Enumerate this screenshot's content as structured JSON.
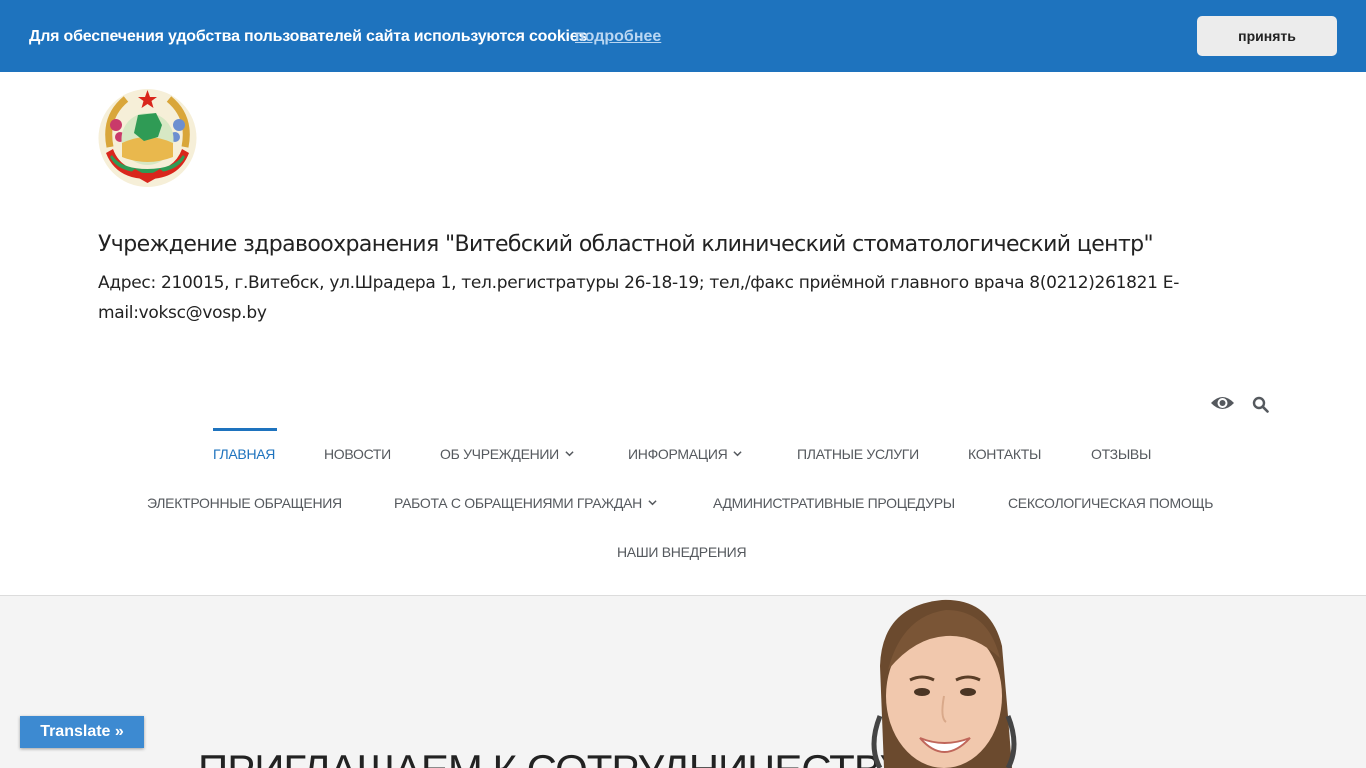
{
  "cookie_bar": {
    "message": "Для обеспечения удобства пользователей сайта используются cookies",
    "more_link": "подробнее",
    "accept_label": "принять",
    "bg_color": "#1e73be"
  },
  "header": {
    "emblem_icon": "belarus-coat-of-arms",
    "title": "Учреждение здравоохранения \"Витебский областной клинический стоматологический центр\"",
    "address": "Адрес: 210015, г.Витебск, ул.Шрадера 1, тел.регистратуры 26-18-19; тел,/факс приёмной главного врача 8(0212)261821 E-mail:voksc@vosp.by"
  },
  "tools": {
    "eye_icon": "eye-icon",
    "search_icon": "search-icon"
  },
  "nav": {
    "accent_color": "#1e73be",
    "row1": [
      {
        "label": "Главная",
        "active": true,
        "dropdown": false
      },
      {
        "label": "Новости",
        "active": false,
        "dropdown": false
      },
      {
        "label": "Об учреждении",
        "active": false,
        "dropdown": true
      },
      {
        "label": "Информация",
        "active": false,
        "dropdown": true
      },
      {
        "label": "Платные услуги",
        "active": false,
        "dropdown": false
      },
      {
        "label": "Контакты",
        "active": false,
        "dropdown": false
      },
      {
        "label": "Отзывы",
        "active": false,
        "dropdown": false
      }
    ],
    "row2": [
      {
        "label": "Электронные обращения",
        "active": false,
        "dropdown": false
      },
      {
        "label": "Работа с обращениями граждан",
        "active": false,
        "dropdown": true
      },
      {
        "label": "Административные процедуры",
        "active": false,
        "dropdown": false
      },
      {
        "label": "Сексологическая помощь",
        "active": false,
        "dropdown": false
      }
    ],
    "row3": [
      {
        "label": "Наши внедрения",
        "active": false,
        "dropdown": false
      }
    ]
  },
  "hero": {
    "title": "Приглашаем к сотрудничеству"
  },
  "translate": {
    "label": "Translate »"
  }
}
